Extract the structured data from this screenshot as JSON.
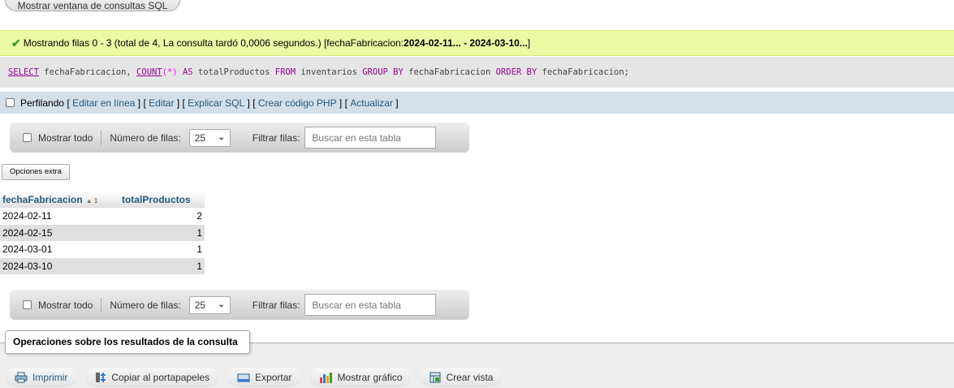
{
  "top_button": {
    "label": "Mostrar ventana de consultas SQL"
  },
  "success": {
    "prefix": "Mostrando filas 0 - 3 (total de 4, La consulta tardó 0,0006 segundos.) [fechaFabricacion: ",
    "range": "2024-02-11... - 2024-03-10...",
    "suffix": "]"
  },
  "sql": {
    "select": "SELECT",
    "part1": " fechaFabricacion, ",
    "count": "COUNT",
    "paren": "(*)",
    "as": " AS",
    "part2": " totalProductos ",
    "from": "FROM",
    "part3": " inventarios ",
    "group_by": "GROUP BY",
    "part4": " fechaFabricacion ",
    "order_by": "ORDER BY",
    "part5": " fechaFabricacion;"
  },
  "profiling": {
    "label": "Perfilando",
    "links": [
      "Editar en línea",
      "Editar",
      "Explicar SQL",
      "Crear código PHP",
      "Actualizar"
    ]
  },
  "nav": {
    "show_all": "Mostrar todo",
    "rows_label": "Número de filas:",
    "rows_value": "25",
    "filter_label": "Filtrar filas:",
    "search_placeholder": "Buscar en esta tabla"
  },
  "extra_options": "Opciones extra",
  "table": {
    "columns": [
      "fechaFabricacion",
      "totalProductos"
    ],
    "sort_indicator": "1",
    "rows": [
      [
        "2024-02-11",
        "2"
      ],
      [
        "2024-02-15",
        "1"
      ],
      [
        "2024-03-01",
        "1"
      ],
      [
        "2024-03-10",
        "1"
      ]
    ]
  },
  "operations": {
    "legend": "Operaciones sobre los resultados de la consulta",
    "buttons": [
      "Imprimir",
      "Copiar al portapapeles",
      "Exportar",
      "Mostrar gráfico",
      "Crear vista"
    ]
  },
  "colors": {
    "success_bg": "#ebf8a4",
    "link": "#235a81",
    "sql_keyword": "#990099"
  }
}
